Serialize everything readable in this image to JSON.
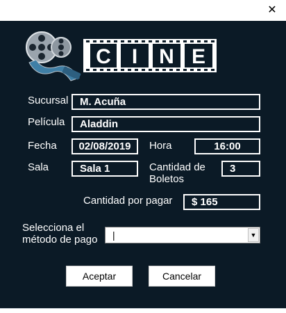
{
  "window": {
    "close_symbol": "✕"
  },
  "logo": {
    "letters": [
      "C",
      "I",
      "N",
      "E"
    ],
    "icon": "film-reel-icon"
  },
  "form": {
    "sucursal_label": "Sucursal",
    "sucursal_value": "M. Acuña",
    "pelicula_label": "Película",
    "pelicula_value": "Aladdin",
    "fecha_label": "Fecha",
    "fecha_value": "02/08/2019",
    "hora_label": "Hora",
    "hora_value": "16:00",
    "sala_label": "Sala",
    "sala_value": "Sala 1",
    "cantidad_boletos_label_line1": "Cantidad de",
    "cantidad_boletos_label_line2": "Boletos",
    "cantidad_boletos_value": "3",
    "cantidad_pagar_label": "Cantidad por pagar",
    "cantidad_pagar_value": "$ 165",
    "metodo_label_line1": "Selecciona el",
    "metodo_label_line2": "método de pago",
    "metodo_value": "|"
  },
  "buttons": {
    "accept": "Aceptar",
    "cancel": "Cancelar"
  },
  "colors": {
    "panel_bg": "#0b1a26",
    "accent": "#ffffff"
  }
}
